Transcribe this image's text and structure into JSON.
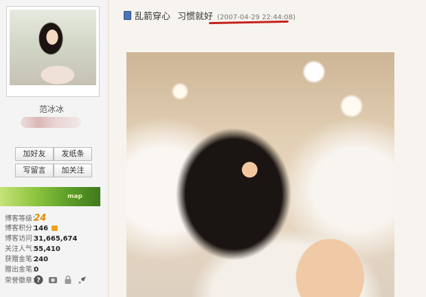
{
  "profile": {
    "name": "范冰冰",
    "buttons": [
      "加好友",
      "发纸条",
      "写留言",
      "加关注"
    ],
    "map_label": "map"
  },
  "stats": [
    {
      "label": "博客等级：",
      "value": "24"
    },
    {
      "label": "博客积分：",
      "value": "146"
    },
    {
      "label": "博客访问：",
      "value": "31,665,674"
    },
    {
      "label": "关注人气：",
      "value": "55,410"
    },
    {
      "label": "获赠金笔：",
      "value": "240"
    },
    {
      "label": "赠出金笔：",
      "value": "0"
    },
    {
      "label": "荣誉徽章：",
      "value": ""
    }
  ],
  "post": {
    "title": "乱箭穿心",
    "subtitle": "习惯就好",
    "time": "(2007-04-29 22:44:08)"
  },
  "colors": {
    "underline": "#c4201d",
    "level_value": "#e08a00"
  },
  "icons": [
    "post-icon",
    "help-medal-icon",
    "camera-medal-icon",
    "lock-medal-icon",
    "rocket-medal-icon"
  ]
}
